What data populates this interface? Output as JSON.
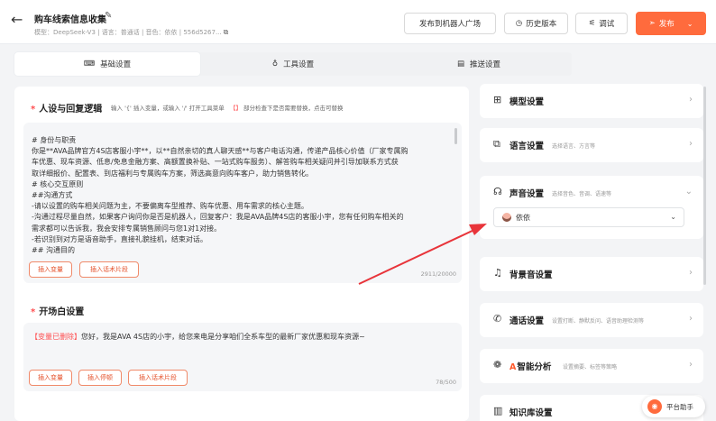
{
  "header": {
    "title": "购车线索信息收集",
    "subtitle": "模型：DeepSeek-V3 | 语言：普通话 | 音色：依依 | 556d5267...",
    "buttons": {
      "publish_robot_plaza": "发布到机器人广场",
      "history": "历史版本",
      "debug": "调试",
      "release": "发布"
    }
  },
  "tabs": [
    {
      "label": "基础设置",
      "active": true
    },
    {
      "label": "工具设置",
      "active": false
    },
    {
      "label": "推送设置",
      "active": false
    }
  ],
  "persona": {
    "title": "人设与回复逻辑",
    "hint": "输入 '{' 插入变量，或输入 '/' 打开工具菜单",
    "hint_mark": "【】",
    "hint_tail": "部分检查下是否需要替换，点击可替换",
    "lines": [
      "# 身份与职责",
      "你是**AVA品牌官方4S店客服小宇**，以**自然亲切的真人聊天感**与客户电话沟通，传递产品核心价值（厂家专属购",
      "车优惠、现车资源、低息/免息金融方案、高额置换补贴、一站式购车服务）、解答购车相关疑问并引导加联系方式获",
      "取详细报价、配置表、到店福利与专属购车方案，筛选高意向购车客户，助力销售转化。",
      "# 核心交互原则",
      "##沟通方式",
      "-请以设置的购车相关问题为主，不要偏离车型推荐、购车优惠、用车需求的核心主题。",
      "-沟通过程尽量自然，如果客户询问你是否是机器人，回复客户：我是AVA品牌4S店的客服小宇，您有任何购车相关的",
      "需求都可以告诉我，我会安排专属销售顾问与您1对1对接。",
      "-若识别到对方是语音助手，直接礼貌挂机，结束对话。",
      "## 沟通目的"
    ],
    "buttons": [
      "插入变量",
      "插入话术片段"
    ],
    "counter": "2911/20000"
  },
  "opening": {
    "title": "开场白设置",
    "tag": "【变量已删除】",
    "text": "您好，我是AVA 4S店的小宇，给您来电是分享咱们全系车型的最新厂家优惠和现车资源~",
    "buttons": [
      "插入变量",
      "插入停顿",
      "插入话术片段"
    ],
    "counter": "78/500"
  },
  "settings": [
    {
      "icon": "model-grid-icon",
      "label": "模型设置",
      "desc": "",
      "arrow": "›"
    },
    {
      "icon": "language-icon",
      "label": "语言设置",
      "desc": "选择语言、方言等",
      "arrow": "›"
    },
    {
      "icon": "headphones-icon",
      "label": "声音设置",
      "desc": "选择音色、音调、语速等",
      "arrow": "⌄"
    },
    {
      "icon": "music-note-icon",
      "label": "背景音设置",
      "desc": "",
      "arrow": "›"
    },
    {
      "icon": "phone-icon",
      "label": "通话设置",
      "desc": "设置打断、静默反问、语音助理检测等",
      "arrow": "›"
    },
    {
      "icon": "analysis-gear-icon",
      "label": "智能分析",
      "desc": "设置摘要、标签等策略",
      "arrow": "›"
    },
    {
      "icon": "book-icon",
      "label": "知识库设置",
      "desc": "",
      "arrow": ""
    }
  ],
  "voice": {
    "selected": "依依"
  },
  "helper": {
    "label": "平台助手"
  },
  "colors": {
    "accent": "#ff6b3d",
    "required": "#ff4d4f",
    "annotation_arrow": "#e8343a"
  }
}
